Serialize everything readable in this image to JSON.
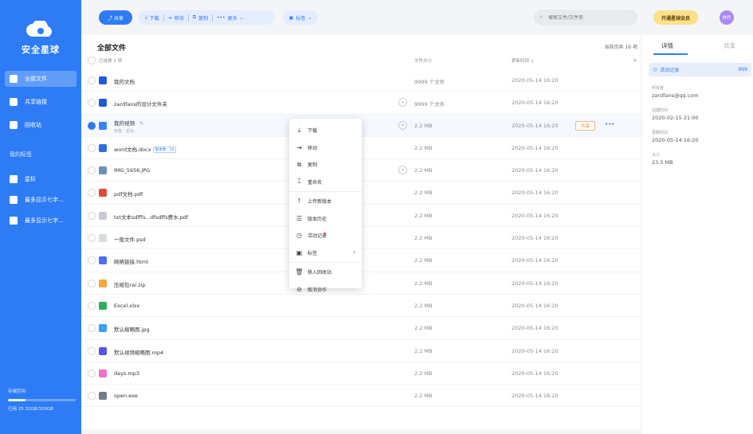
{
  "app": {
    "name": "安全星球"
  },
  "sidebar": {
    "items": [
      {
        "label": "全部文件",
        "icon": "folder-icon",
        "active": true
      },
      {
        "label": "共享链接",
        "icon": "link-icon"
      },
      {
        "label": "回收站",
        "icon": "trash-icon"
      }
    ],
    "tags_title": "我的标签",
    "tags": [
      {
        "label": "星标",
        "icon": "tag-icon"
      },
      {
        "label": "最多显示七字...",
        "icon": "tag-icon"
      },
      {
        "label": "最多显示七字...",
        "icon": "tag-icon"
      }
    ],
    "storage": {
      "title": "存储空间",
      "usage": "已用 25.32GB/100GB",
      "fraction": 0.2532
    }
  },
  "toolbar": {
    "share": "共享",
    "download": "下载",
    "move": "移动",
    "copy": "复制",
    "more": "更多",
    "tag": "标签",
    "search_placeholder": "搜索文件/文件夹",
    "member": "开通星球会员",
    "avatar": "林乔"
  },
  "main": {
    "title": "全部文件",
    "page_count": "当前页共 16 项",
    "selected_count": "已选择 1 项",
    "columns": {
      "size": "文件大小",
      "date": "更新时间 ↓"
    },
    "rows": [
      {
        "name": "我的文档",
        "size": "9999 个文件",
        "date": "2020-05-14 16:20",
        "icon": "folder-icon",
        "color": "#1f5bd8"
      },
      {
        "name": "zardfans的设计文件夹",
        "size": "9999 个文件",
        "date": "2020-05-14 16:20",
        "icon": "folder-icon",
        "color": "#1f5bd8",
        "linked": true
      },
      {
        "name": "我的视频",
        "sub": "标签：星标、",
        "size": "2.2 MB",
        "date": "2020-05-14 16:20",
        "icon": "video-folder-icon",
        "color": "#3b82f6",
        "linked": true,
        "selected": true
      },
      {
        "name": "word文档.docx",
        "badge": "版本数：10",
        "size": "2.2 MB",
        "date": "2020-05-14 16:20",
        "icon": "word-icon",
        "color": "#2f6fe0"
      },
      {
        "name": "IMG_5656.JPG",
        "size": "2.2 MB",
        "date": "2020-05-14 16:20",
        "icon": "image-thumb-icon",
        "color": "#6b8fb5",
        "linked": true
      },
      {
        "name": "pdf文档.pdf",
        "size": "2.2 MB",
        "date": "2020-05-14 16:20",
        "icon": "pdf-icon",
        "color": "#e04a3a"
      },
      {
        "name": "txt文本sdfffs...dfsdffs费水.pdf",
        "size": "2.2 MB",
        "date": "2020-05-14 16:20",
        "icon": "txt-icon",
        "color": "#c9ccd2"
      },
      {
        "name": "一般文件.psd",
        "size": "2.2 MB",
        "date": "2020-05-14 16:20",
        "icon": "file-icon",
        "color": "#d8dbe0"
      },
      {
        "name": "网络链接.html",
        "size": "2.2 MB",
        "date": "2020-05-14 16:20",
        "icon": "html-icon",
        "color": "#4b6ef5"
      },
      {
        "name": "压缩包rar.zip",
        "size": "2.2 MB",
        "date": "2020-05-14 16:20",
        "icon": "zip-icon",
        "color": "#f0a93a"
      },
      {
        "name": "Excel.xlsx",
        "size": "2.2 MB",
        "date": "2020-05-14 16:20",
        "icon": "excel-icon",
        "color": "#2fae5a"
      },
      {
        "name": "默认缩略图.jpg",
        "size": "2.2 MB",
        "date": "2020-05-14 16:20",
        "icon": "image-icon",
        "color": "#3ba0f0"
      },
      {
        "name": "默认视频缩略图.mp4",
        "size": "2.2 MB",
        "date": "2020-05-14 16:20",
        "icon": "video-icon",
        "color": "#5a54e8"
      },
      {
        "name": "days.mp3",
        "size": "2.2 MB",
        "date": "2020-05-14 16:20",
        "icon": "audio-icon",
        "color": "#f071c8"
      },
      {
        "name": "open.exe",
        "size": "2.2 MB",
        "date": "2020-05-14 16:20",
        "icon": "exe-icon",
        "color": "#6f7a8a"
      }
    ],
    "row_share": "共享",
    "row_more": "•••"
  },
  "context_menu": [
    {
      "label": "下载",
      "glyph": "⤓"
    },
    {
      "label": "移动",
      "glyph": "⇥"
    },
    {
      "label": "复制",
      "glyph": "⧉"
    },
    {
      "label": "重命名",
      "glyph": "⌶"
    },
    {
      "divider": true
    },
    {
      "label": "上传新版本",
      "glyph": "⤒"
    },
    {
      "label": "版本历史",
      "glyph": "☰"
    },
    {
      "label": "活动记录",
      "glyph": "◷",
      "dot": true
    },
    {
      "label": "标签",
      "glyph": "▣",
      "arrow": "›"
    },
    {
      "divider": true
    },
    {
      "label": "移入回收站",
      "glyph": "🗑"
    },
    {
      "label": "取消协作",
      "glyph": "⊖"
    }
  ],
  "details": {
    "tab_details": "详情",
    "tab_share": "共享",
    "activity_label": "活动记录",
    "activity_count": "999",
    "owner_label": "所有者",
    "owner": "zardfans@qq.com",
    "created_label": "创建时间",
    "created": "2020-02-15 21:00",
    "updated_label": "更新时间",
    "updated": "2020-05-14 16:20",
    "size_label": "大小",
    "size": "23.5 MB"
  },
  "colors": {
    "primary": "#2d7cf6",
    "member": "#fde08a",
    "avatar": "#a98af5",
    "share_outline": "#f08a2a"
  }
}
